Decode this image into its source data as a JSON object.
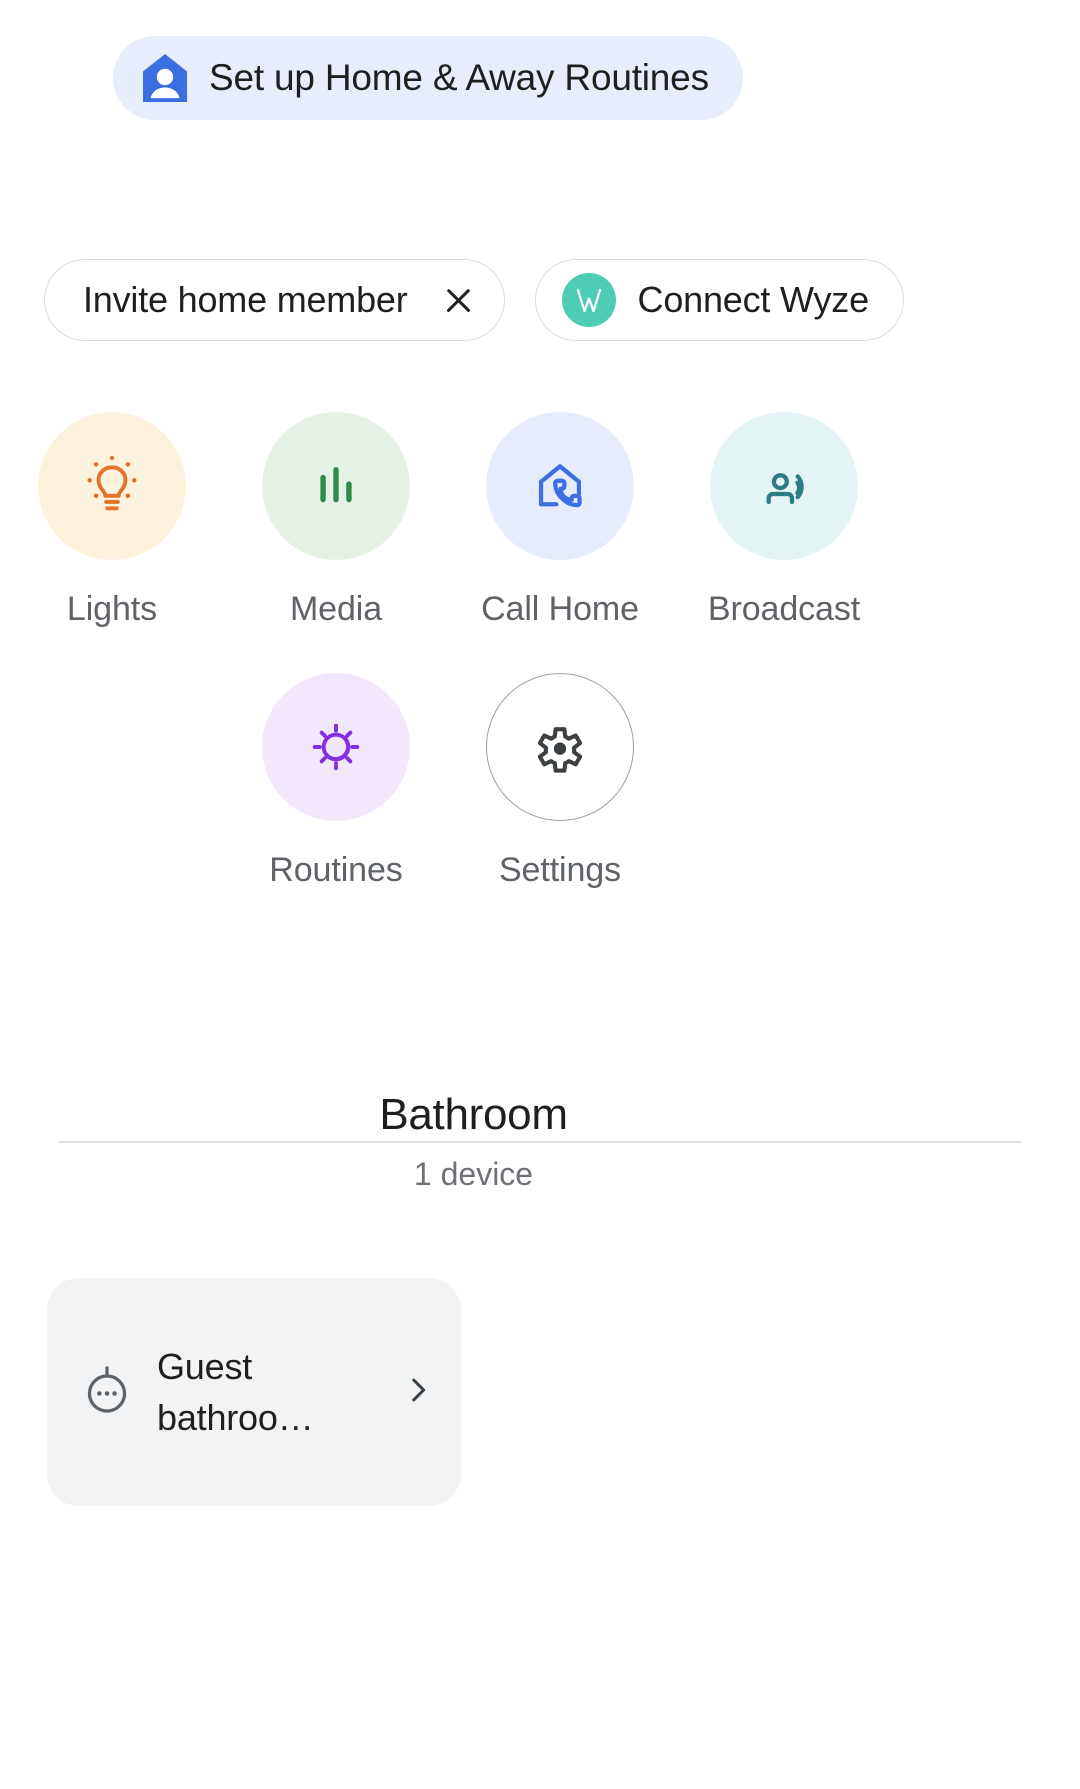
{
  "suggestion": {
    "label": "Set up Home & Away Routines",
    "icon": "home-person-icon",
    "background": "#e7edfb",
    "icon_color": "#3b6fe0"
  },
  "chips": [
    {
      "label": "Invite home member",
      "dismiss_icon": "close-icon",
      "has_badge": false
    },
    {
      "label": "Connect Wyze",
      "badge_icon": "wyze-logo-icon",
      "badge_letter": "W",
      "badge_color": "#4ecdb4",
      "has_badge": true
    }
  ],
  "quick_actions": {
    "row1": [
      {
        "label": "Lights",
        "icon": "lightbulb-icon",
        "bubble_color": "#fdf3dd",
        "icon_color": "#e2742a"
      },
      {
        "label": "Media",
        "icon": "equalizer-bars-icon",
        "bubble_color": "#e6f1e6",
        "icon_color": "#2f8b46"
      },
      {
        "label": "Call Home",
        "icon": "call-home-icon",
        "bubble_color": "#e7ecfc",
        "icon_color": "#3c6fe5"
      },
      {
        "label": "Broadcast",
        "icon": "broadcast-icon",
        "bubble_color": "#e4f3f4",
        "icon_color": "#2c7b85"
      }
    ],
    "row2": [
      {
        "label": "Routines",
        "icon": "routines-sun-icon",
        "bubble_color": "#f3e8fb",
        "icon_color": "#8430e0"
      },
      {
        "label": "Settings",
        "icon": "gear-icon",
        "bubble_color": "#ffffff",
        "icon_color": "#3c4043",
        "outlined": true
      }
    ]
  },
  "room": {
    "name": "Bathroom",
    "device_count_label": "1 device"
  },
  "devices": [
    {
      "name": "Guest bathroo…",
      "icon": "sensor-device-icon",
      "chevron_icon": "chevron-right-icon"
    }
  ]
}
